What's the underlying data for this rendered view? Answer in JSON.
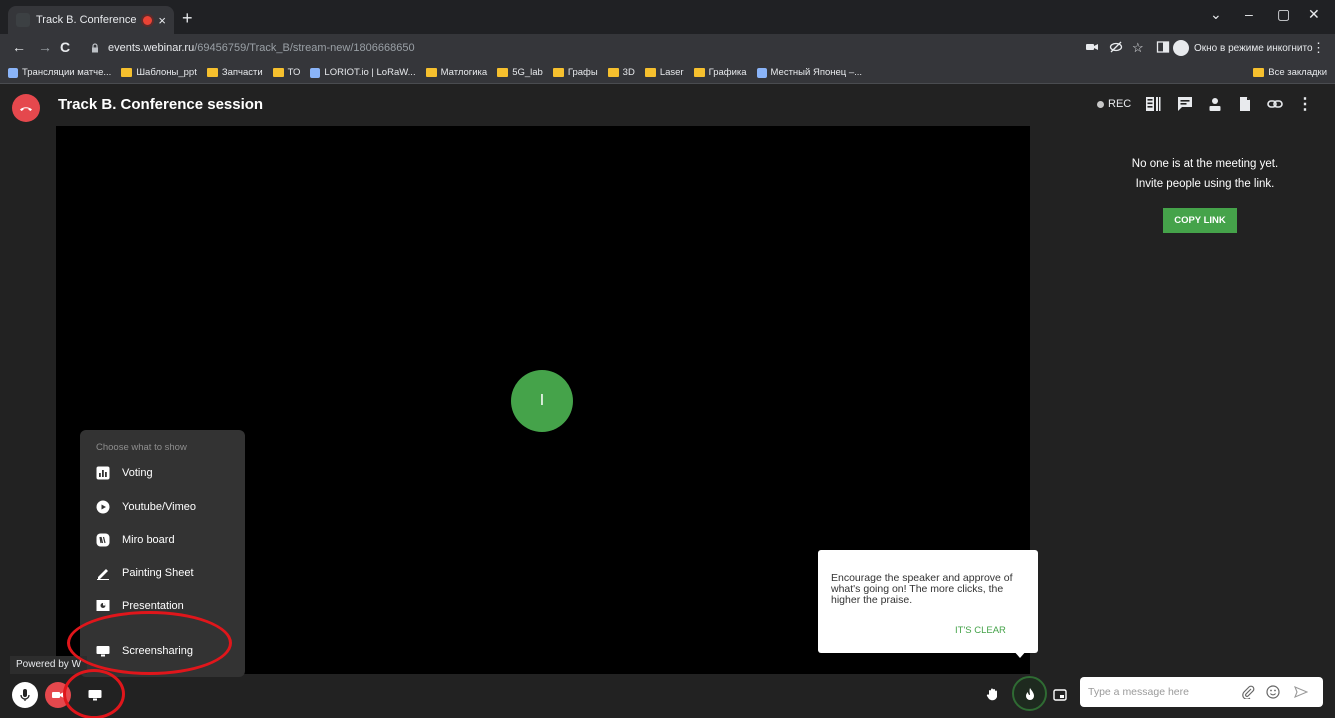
{
  "browser": {
    "tab_title": "Track B. Conference session",
    "tab_close": "×",
    "new_tab": "+",
    "window_controls": [
      "⌄",
      "–",
      "▢",
      "✕"
    ],
    "nav": {
      "back": "←",
      "forward": "→",
      "reload": "C"
    },
    "url_host": "events.webinar.ru",
    "url_path": "/69456759/Track_B/stream-new/1806668650",
    "incognito_label": "Окно в режиме инкогнито",
    "bookmarks": [
      {
        "label": "Трансляции матче...",
        "kind": "site"
      },
      {
        "label": "Шаблоны_ppt",
        "kind": "folder"
      },
      {
        "label": "Запчасти",
        "kind": "folder"
      },
      {
        "label": "ТО",
        "kind": "folder"
      },
      {
        "label": "LORIOT.io | LoRaW...",
        "kind": "site"
      },
      {
        "label": "Матлогика",
        "kind": "folder"
      },
      {
        "label": "5G_lab",
        "kind": "folder"
      },
      {
        "label": "Графы",
        "kind": "folder"
      },
      {
        "label": "3D",
        "kind": "folder"
      },
      {
        "label": "Laser",
        "kind": "folder"
      },
      {
        "label": "Графика",
        "kind": "folder"
      },
      {
        "label": "Местный Японец –...",
        "kind": "site"
      }
    ],
    "all_bookmarks": "Все закладки"
  },
  "app": {
    "title": "Track B. Conference session",
    "rec_label": "REC",
    "avatar_initial": "I",
    "empty_line1": "No one is at the meeting yet.",
    "empty_line2": "Invite people using the link.",
    "copy_link": "COPY LINK",
    "powered_by": "Powered by W"
  },
  "show_menu": {
    "caption": "Choose what to show",
    "items": [
      {
        "label": "Voting",
        "icon": "voting-icon"
      },
      {
        "label": "Youtube/Vimeo",
        "icon": "youtube-icon"
      },
      {
        "label": "Miro board",
        "icon": "miro-icon"
      },
      {
        "label": "Painting Sheet",
        "icon": "pencil-icon"
      },
      {
        "label": "Presentation",
        "icon": "presentation-icon"
      },
      {
        "label": "Screensharing",
        "icon": "monitor-icon"
      }
    ]
  },
  "tooltip": {
    "text": "Encourage the speaker and approve of what's going on! The more clicks, the higher the praise.",
    "button": "IT'S CLEAR"
  },
  "chat": {
    "placeholder": "Type a message here"
  },
  "colors": {
    "accent_green": "#45a34a",
    "hangup_red": "#e5484d",
    "annotation_red": "#e0161b",
    "app_bg": "#222222"
  }
}
